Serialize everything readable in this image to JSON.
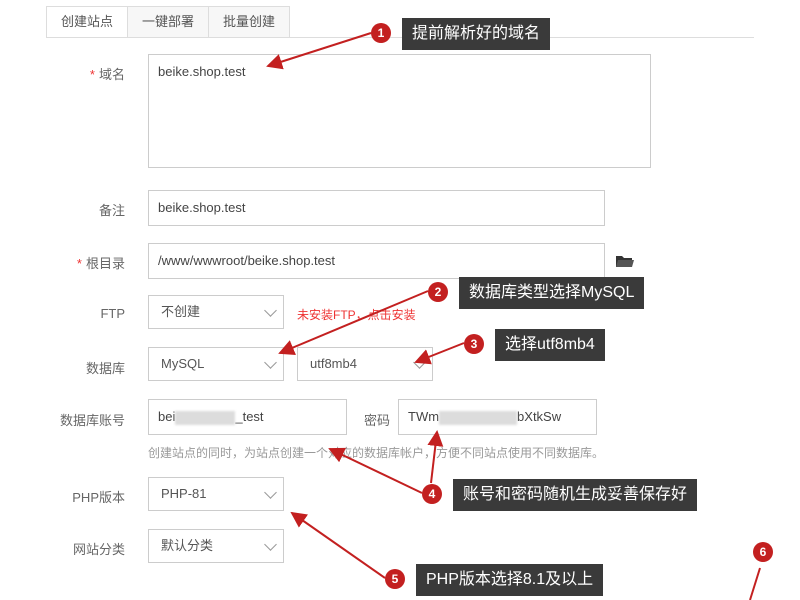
{
  "tabs": [
    "创建站点",
    "一键部署",
    "批量创建"
  ],
  "form": {
    "domain_label": "域名",
    "domain_value": "beike.shop.test",
    "remark_label": "备注",
    "remark_value": "beike.shop.test",
    "root_label": "根目录",
    "root_value": "/www/wwwroot/beike.shop.test",
    "ftp_label": "FTP",
    "ftp_value": "不创建",
    "ftp_warning": "未安装FTP，点击安装",
    "db_label": "数据库",
    "db_type": "MySQL",
    "db_charset": "utf8mb4",
    "db_account_label": "数据库账号",
    "db_account_prefix": "bei",
    "db_account_suffix": "_test",
    "password_label": "密码",
    "password_prefix": "TWm",
    "password_suffix": "bXtkSw",
    "db_hint": "创建站点的同时，为站点创建一个对应的数据库帐户，方便不同站点使用不同数据库。",
    "php_label": "PHP版本",
    "php_value": "PHP-81",
    "category_label": "网站分类",
    "category_value": "默认分类"
  },
  "annotations": [
    {
      "num": "1",
      "text": "提前解析好的域名"
    },
    {
      "num": "2",
      "text": "数据库类型选择MySQL"
    },
    {
      "num": "3",
      "text": "选择utf8mb4"
    },
    {
      "num": "4",
      "text": "账号和密码随机生成妥善保存好"
    },
    {
      "num": "5",
      "text": "PHP版本选择8.1及以上"
    },
    {
      "num": "6",
      "text": ""
    }
  ],
  "colors": {
    "accent": "#c32020",
    "callout_bg": "#3a3a3a"
  }
}
